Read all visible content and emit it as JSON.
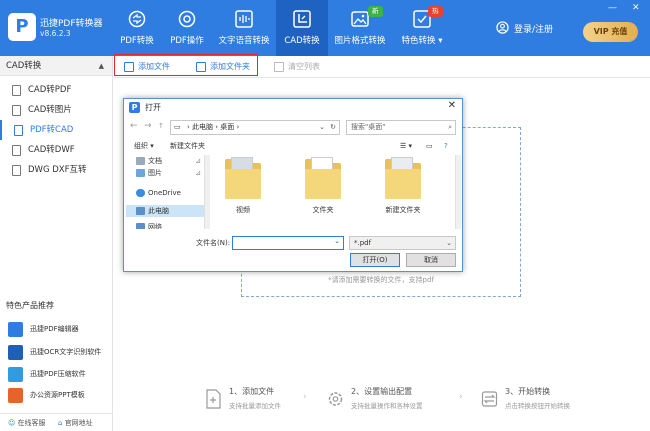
{
  "app": {
    "name": "迅捷PDF转换器",
    "version": "v8.6.2.3",
    "logo_letter": "P"
  },
  "colors": {
    "primary": "#2f7de1",
    "header_active": "#1f63c2",
    "highlight_red": "#e02c2c",
    "badge_new": "#3bb34a",
    "badge_hot": "#e8412c"
  },
  "nav": [
    {
      "label": "PDF转换",
      "icon": "convert-icon"
    },
    {
      "label": "PDF操作",
      "icon": "target-icon"
    },
    {
      "label": "文字语音转换",
      "icon": "waveform-icon"
    },
    {
      "label": "CAD转换",
      "icon": "cad-icon",
      "active": true
    },
    {
      "label": "图片格式转换",
      "icon": "image-icon",
      "badge": "新"
    },
    {
      "label": "特色转换",
      "icon": "special-icon",
      "badge": "热",
      "has_dropdown": true
    }
  ],
  "header": {
    "login": "登录/注册",
    "vip": "VIP 充值"
  },
  "window_controls": {
    "minimize": "—",
    "close": "✕"
  },
  "sidebar": {
    "section": "CAD转换",
    "items": [
      {
        "label": "CAD转PDF"
      },
      {
        "label": "CAD转图片"
      },
      {
        "label": "PDF转CAD",
        "active": true
      },
      {
        "label": "CAD转DWF"
      },
      {
        "label": "DWG DXF互转"
      }
    ],
    "featured_title": "特色产品推荐",
    "featured": [
      {
        "label": "迅捷PDF编辑器",
        "icon": "pdf-editor-icon"
      },
      {
        "label": "迅捷OCR文字识别软件",
        "icon": "ocr-icon"
      },
      {
        "label": "迅捷PDF压缩软件",
        "icon": "pdf-compress-icon"
      },
      {
        "label": "办公资源PPT模板",
        "icon": "ppt-icon"
      }
    ],
    "footer": {
      "support": "在线客服",
      "website": "官网地址"
    }
  },
  "toolbar": {
    "add_file": "添加文件",
    "add_folder": "添加文件夹",
    "clear_list": "清空列表"
  },
  "drop_hint": "*请添加需要转换的文件，支持pdf",
  "steps": [
    {
      "title": "1、添加文件",
      "sub": "支持批量添加文件"
    },
    {
      "title": "2、设置输出配置",
      "sub": "支持批量操作和各种设置"
    },
    {
      "title": "3、开始转换",
      "sub": "点击转换按钮开始转换"
    }
  ],
  "dialog": {
    "title": "打开",
    "address": [
      "此电脑",
      "桌面"
    ],
    "search_placeholder": "搜索\"桌面\"",
    "organize": "组织 ▾",
    "new_folder": "新建文件夹",
    "nav_items": [
      "文档",
      "图片",
      "OneDrive",
      "此电脑",
      "网络"
    ],
    "files": [
      "视频",
      "文件夹",
      "新建文件夹"
    ],
    "filename_label": "文件名(N):",
    "filename_value": "",
    "filetype": "*.pdf",
    "open_button": "打开(O)",
    "cancel_button": "取消"
  }
}
